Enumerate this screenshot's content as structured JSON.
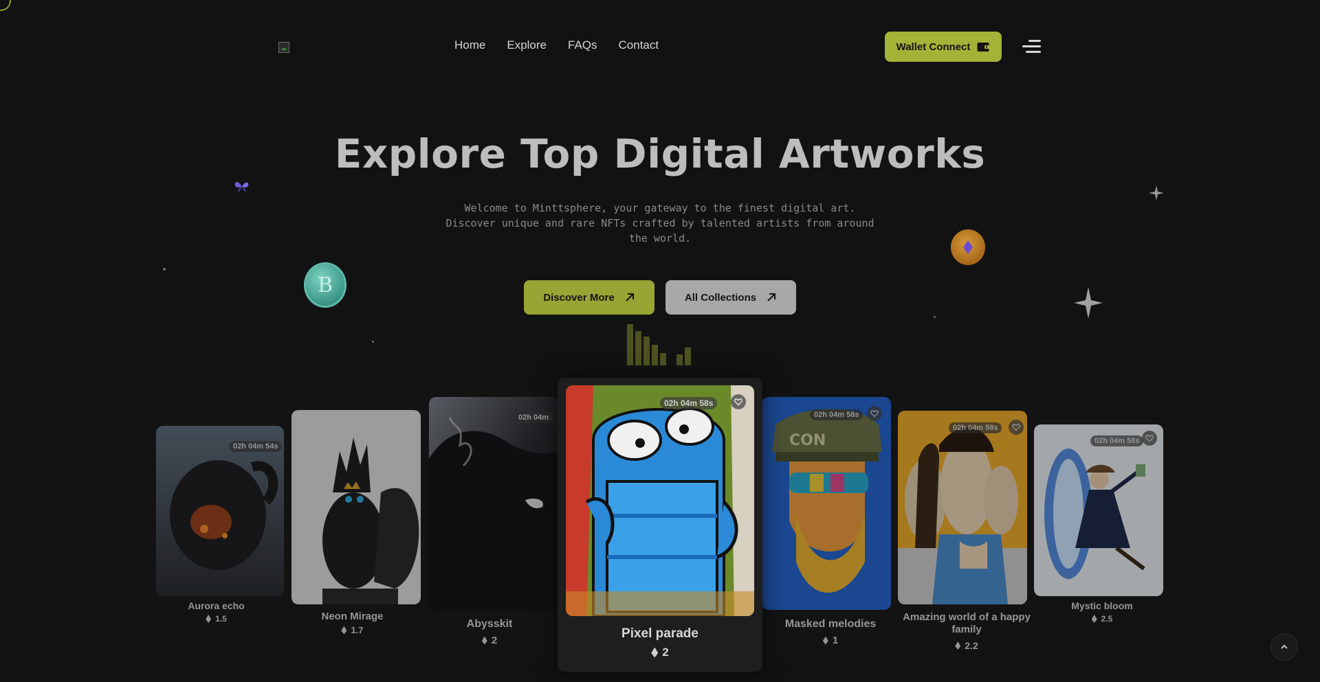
{
  "header": {
    "nav": [
      "Home",
      "Explore",
      "FAQs",
      "Contact"
    ],
    "wallet_label": "Wallet Connect"
  },
  "hero": {
    "title": "Explore Top Digital Artworks",
    "subtitle": "Welcome to Minttsphere, your gateway to the finest digital art. Discover unique and rare NFTs crafted by talented artists from around the world.",
    "discover_label": "Discover More",
    "collections_label": "All Collections",
    "coin_symbol": "B"
  },
  "cards": [
    {
      "name": "Aurora echo",
      "price": "1.5",
      "timer": "02h 04m 54s"
    },
    {
      "name": "Neon Mirage",
      "price": "1.7"
    },
    {
      "name": "Abysskit",
      "price": "2",
      "timer": "02h 04m"
    },
    {
      "name": "Pixel parade",
      "price": "2",
      "timer": "02h 04m 58s"
    },
    {
      "name": "Masked melodies",
      "price": "1",
      "timer": "02h 04m 58s"
    },
    {
      "name": "Amazing world of a happy family",
      "price": "2.2",
      "timer": "02h 04m 58s"
    },
    {
      "name": "Mystic bloom",
      "price": "2.5",
      "timer": "02h 04m 58s"
    }
  ],
  "colors": {
    "accent": "#a4b237",
    "background": "#121212",
    "secondary_button": "#a8a8a8"
  },
  "icons": [
    "logo-icon",
    "wallet-icon",
    "menu-icon",
    "arrow-up-right-icon",
    "bitcoin-coin-icon",
    "ethereum-coin-icon",
    "butterfly-icon",
    "sparkle-icon",
    "heart-icon",
    "ethereum-icon",
    "chevron-up-icon"
  ]
}
